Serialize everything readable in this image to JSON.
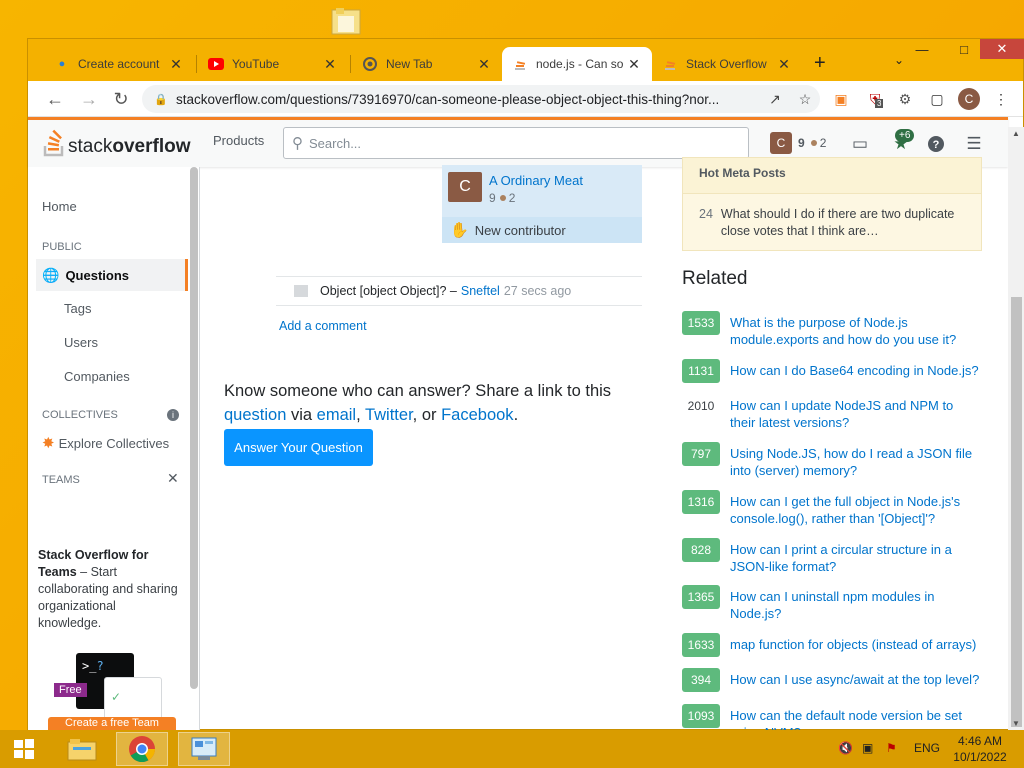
{
  "browser": {
    "tabs": [
      {
        "label": "Create account",
        "icon": "account-icon"
      },
      {
        "label": "YouTube",
        "icon": "youtube-icon"
      },
      {
        "label": "New Tab",
        "icon": "chrome-icon"
      },
      {
        "label": "node.js - Can so",
        "icon": "stackoverflow-icon"
      },
      {
        "label": "Stack Overflow",
        "icon": "stackoverflow-icon"
      }
    ],
    "url": "stackoverflow.com/questions/73916970/can-someone-please-object-object-this-thing?nor...",
    "ext_badge": "3",
    "profile_initial": "C"
  },
  "so_header": {
    "logo_stack": "stack",
    "logo_overflow": "overflow",
    "products_label": "Products",
    "search_placeholder": "Search...",
    "user_initial": "C",
    "user_rep": "9",
    "user_bronze": "2",
    "achievements_badge": "+6"
  },
  "leftnav": {
    "home": "Home",
    "public_head": "PUBLIC",
    "questions": "Questions",
    "tags": "Tags",
    "users": "Users",
    "companies": "Companies",
    "collectives_head": "COLLECTIVES",
    "explore_collectives": "Explore Collectives",
    "teams_head": "TEAMS",
    "teams_title": "Stack Overflow for Teams",
    "teams_desc": " – Start collaborating and sharing organizational knowledge.",
    "free_badge": "Free",
    "create_team": "Create a free Team"
  },
  "question": {
    "author_initial": "C",
    "author_name": "A Ordinary Meat",
    "author_rep": "9",
    "author_bronze": "2",
    "new_contributor": "New contributor",
    "comment_text": "Object [object Object]? –",
    "comment_user": "Sneftel",
    "comment_time": "27 secs ago",
    "add_comment": "Add a comment",
    "share_prefix": "Know someone who can answer? Share a link to this ",
    "share_question": "question",
    "share_via": " via ",
    "share_email": "email",
    "share_comma": ", ",
    "share_twitter": "Twitter",
    "share_or": ", or ",
    "share_facebook": "Facebook",
    "share_end": ".",
    "answer_button": "Answer Your Question"
  },
  "meta": {
    "head": "Hot Meta Posts",
    "item_num": "24",
    "item_text": "What should I do if there are two duplicate close votes that I think are…"
  },
  "related": {
    "title": "Related",
    "items": [
      {
        "score": "1533",
        "accepted": true,
        "text": "What is the purpose of Node.js module.exports and how do you use it?"
      },
      {
        "score": "1131",
        "accepted": true,
        "text": "How can I do Base64 encoding in Node.js?"
      },
      {
        "score": "2010",
        "accepted": false,
        "text": "How can I update NodeJS and NPM to their latest versions?"
      },
      {
        "score": "797",
        "accepted": true,
        "text": "Using Node.JS, how do I read a JSON file into (server) memory?"
      },
      {
        "score": "1316",
        "accepted": true,
        "text": "How can I get the full object in Node.js's console.log(), rather than '[Object]'?"
      },
      {
        "score": "828",
        "accepted": true,
        "text": "How can I print a circular structure in a JSON-like format?"
      },
      {
        "score": "1365",
        "accepted": true,
        "text": "How can I uninstall npm modules in Node.js?"
      },
      {
        "score": "1633",
        "accepted": true,
        "text": "map function for objects (instead of arrays)"
      },
      {
        "score": "394",
        "accepted": true,
        "text": "How can I use async/await at the top level?"
      },
      {
        "score": "1093",
        "accepted": true,
        "text": "How can the default node version be set using NVM?"
      }
    ]
  },
  "taskbar": {
    "lang": "ENG",
    "time": "4:46 AM",
    "date": "10/1/2022"
  },
  "colors": {
    "accent": "#f48024",
    "link": "#0074cc",
    "accepted": "#5eba7d",
    "button": "#0a95ff"
  }
}
